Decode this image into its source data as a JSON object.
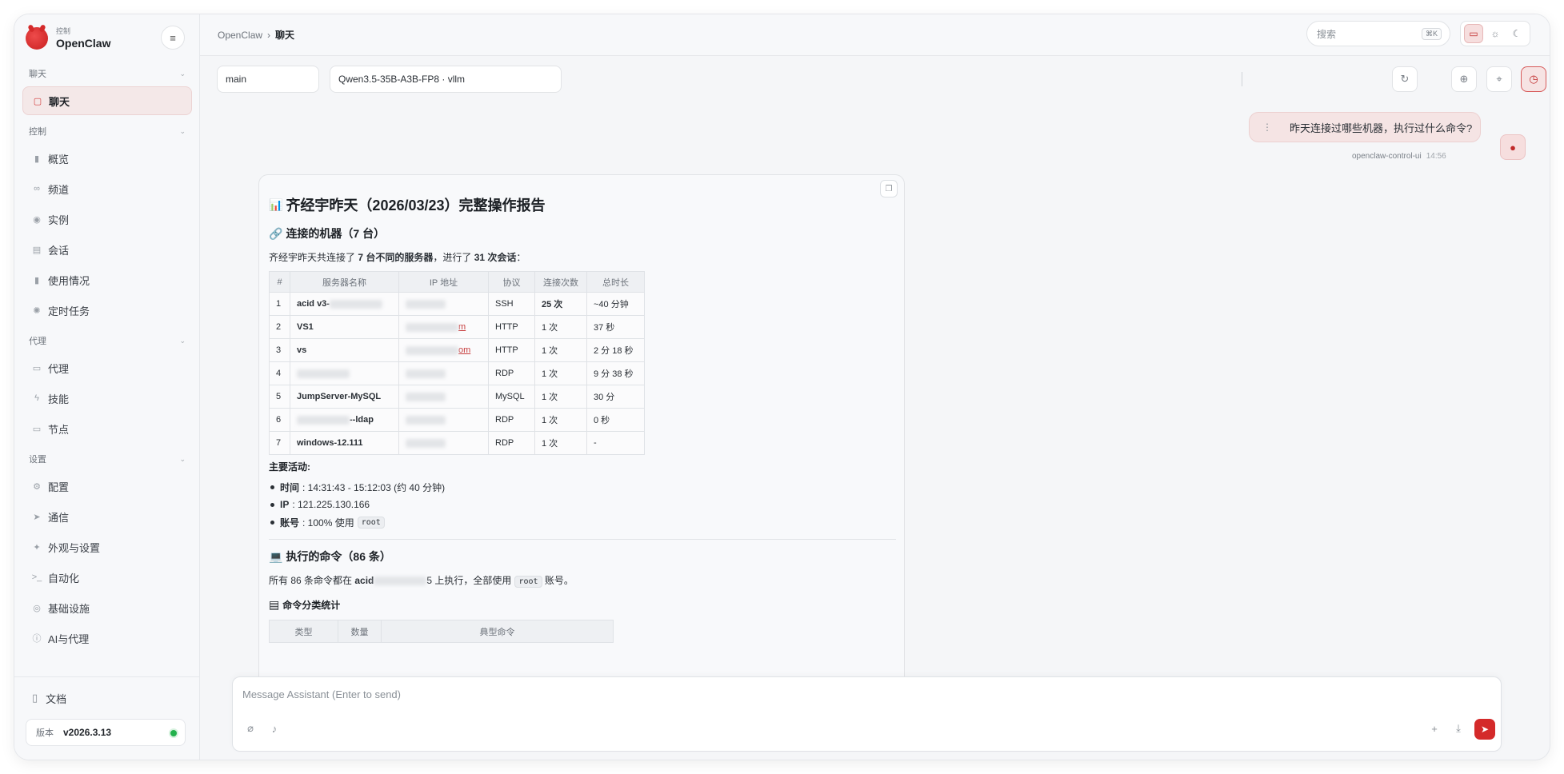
{
  "brand": {
    "sub": "控制",
    "name": "OpenClaw"
  },
  "sidebar": {
    "groups": [
      {
        "title": "聊天",
        "items": [
          {
            "label": "聊天",
            "icon": "chat-icon",
            "active": true
          }
        ]
      },
      {
        "title": "控制",
        "items": [
          {
            "label": "概览",
            "icon": "bar-chart-icon"
          },
          {
            "label": "频道",
            "icon": "link-icon"
          },
          {
            "label": "实例",
            "icon": "broadcast-icon"
          },
          {
            "label": "会话",
            "icon": "document-icon"
          },
          {
            "label": "使用情况",
            "icon": "bar-chart-icon"
          },
          {
            "label": "定时任务",
            "icon": "timer-icon"
          }
        ]
      },
      {
        "title": "代理",
        "items": [
          {
            "label": "代理",
            "icon": "folder-icon"
          },
          {
            "label": "技能",
            "icon": "bolt-icon"
          },
          {
            "label": "节点",
            "icon": "monitor-icon"
          }
        ]
      },
      {
        "title": "设置",
        "items": [
          {
            "label": "配置",
            "icon": "gear-icon"
          },
          {
            "label": "通信",
            "icon": "send-icon"
          },
          {
            "label": "外观与设置",
            "icon": "sparkle-icon"
          },
          {
            "label": "自动化",
            "icon": "terminal-icon"
          },
          {
            "label": "基础设施",
            "icon": "globe-icon"
          },
          {
            "label": "AI与代理",
            "icon": "info-icon"
          }
        ]
      }
    ],
    "docs_label": "文档",
    "version_label": "版本",
    "version_value": "v2026.3.13"
  },
  "topbar": {
    "breadcrumb_root": "OpenClaw",
    "breadcrumb_current": "聊天",
    "search_placeholder": "搜索",
    "search_shortcut": "⌘K"
  },
  "session": {
    "value": "main"
  },
  "model": {
    "value": "Qwen3.5-35B-A3B-FP8 · vllm"
  },
  "user_message": {
    "text": "昨天连接过哪些机器，执行过什么命令?",
    "sender": "openclaw-control-ui",
    "time": "14:56"
  },
  "report": {
    "title": "齐经宇昨天（2026/03/23）完整操作报告",
    "machines_heading": "连接的机器（7 台）",
    "summary_prefix": "齐经宇昨天共连接了",
    "summary_servers": "7 台不同的服务器",
    "summary_mid": "，进行了",
    "summary_sessions": "31 次会话",
    "summary_suffix": "：",
    "table_headers": [
      "#",
      "服务器名称",
      "IP 地址",
      "协议",
      "连接次数",
      "总时长"
    ],
    "rows": [
      {
        "n": "1",
        "name": "acid v3-",
        "ip_link": "",
        "proto": "SSH",
        "count": "25 次",
        "duration": "~40 分钟"
      },
      {
        "n": "2",
        "name": "VS1",
        "ip_link": "m",
        "proto": "HTTP",
        "count": "1 次",
        "duration": "37 秒"
      },
      {
        "n": "3",
        "name": "vs",
        "ip_link": "om",
        "proto": "HTTP",
        "count": "1 次",
        "duration": "2 分 18 秒"
      },
      {
        "n": "4",
        "name": "",
        "ip_link": "",
        "proto": "RDP",
        "count": "1 次",
        "duration": "9 分 38 秒"
      },
      {
        "n": "5",
        "name": "JumpServer-MySQL",
        "ip_link": "",
        "proto": "MySQL",
        "count": "1 次",
        "duration": "30 分"
      },
      {
        "n": "6",
        "name": "--ldap",
        "ip_link": "",
        "proto": "RDP",
        "count": "1 次",
        "duration": "0 秒"
      },
      {
        "n": "7",
        "name": "windows-12.111",
        "ip_link": "",
        "proto": "RDP",
        "count": "1 次",
        "duration": "-"
      }
    ],
    "activities_title": "主要活动:",
    "activities": [
      {
        "label": "时间",
        "value": ": 14:31:43 - 15:12:03 (约 40 分钟)"
      },
      {
        "label": "IP",
        "value": ": 121.225.130.166"
      },
      {
        "label": "账号",
        "value": ": 100% 使用",
        "code": "root"
      }
    ],
    "commands_heading": "执行的命令（86 条）",
    "commands_prefix": "所有 86 条命令都在",
    "commands_host": "acid",
    "commands_host_tail": "5",
    "commands_mid": "上执行，全部使用",
    "commands_code": "root",
    "commands_suffix": "账号。",
    "category_heading": "命令分类统计",
    "category_headers": [
      "类型",
      "数量",
      "典型命令"
    ]
  },
  "composer": {
    "placeholder": "Message Assistant (Enter to send)"
  },
  "colors": {
    "accent": "#d42a2a",
    "status_online": "#22b14c"
  }
}
